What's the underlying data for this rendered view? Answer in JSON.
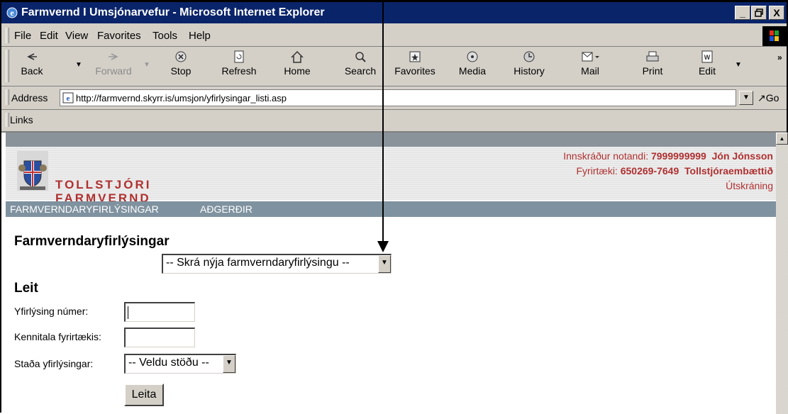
{
  "window": {
    "title": "Farmvernd I Umsjónarvefur - Microsoft Internet Explorer",
    "controls": [
      "_",
      "□",
      "X"
    ]
  },
  "menu": [
    "File",
    "Edit",
    "View",
    "Favorites",
    "Tools",
    "Help"
  ],
  "toolbar": {
    "back": "Back",
    "forward": "Forward",
    "stop": "Stop",
    "refresh": "Refresh",
    "home": "Home",
    "search": "Search",
    "favorites": "Favorites",
    "media": "Media",
    "history": "History",
    "mail": "Mail",
    "print": "Print",
    "edit": "Edit",
    "chevron": "»"
  },
  "address": {
    "label": "Address",
    "url": "http://farmvernd.skyrr.is/umsjon/yfirlysingar_listi.asp",
    "go": "Go"
  },
  "links_label": "Links",
  "site": {
    "logo_line1": "TOLLSTJÓRI",
    "logo_line2": "FARMVERND",
    "user_label": "Innskráður notandi:",
    "user_id": "7999999999",
    "user_name": "Jón Jónsson",
    "company_label": "Fyrirtæki:",
    "company_id": "650269-7649",
    "company_name": "Tollstjóraembættið",
    "logout": "Útskráning",
    "nav": [
      "FARMVERNDARYFIRLÝSINGAR",
      "AÐGERÐIR"
    ]
  },
  "page": {
    "heading": "Farmverndaryfirlýsingar",
    "new_select": "-- Skrá nýja farmverndaryfirlýsingu --",
    "search_heading": "Leit",
    "field_number": "Yfirlýsing númer:",
    "field_company": "Kennitala fyrirtækis:",
    "field_status": "Staða yfirlýsingar:",
    "status_select": "-- Veldu stöðu --",
    "search_button": "Leita"
  },
  "colors": {
    "titlebar": "#0a246a",
    "chrome": "#d4d0c8",
    "site_red": "#b03030",
    "site_nav": "#7f929f"
  }
}
